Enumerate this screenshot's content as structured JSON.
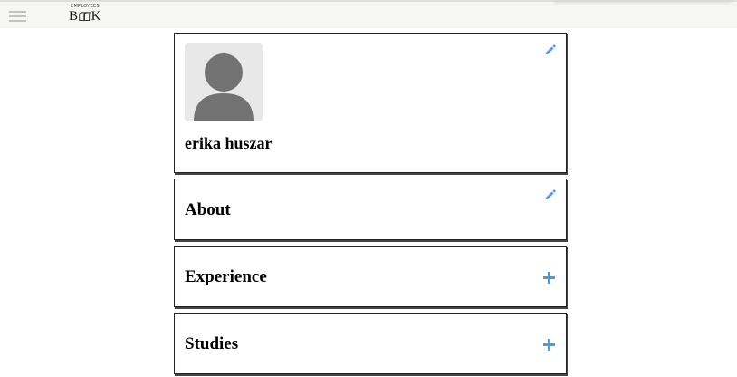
{
  "header": {
    "logo_small": "EMPLOYEES",
    "logo_b": "B",
    "logo_k": "K",
    "menu_icon": "hamburger-icon"
  },
  "profile": {
    "name": "erika huszar",
    "avatar_icon": "default-avatar-icon",
    "edit_icon": "pencil-icon"
  },
  "sections": {
    "about": {
      "title": "About",
      "action_icon": "pencil-icon"
    },
    "experience": {
      "title": "Experience",
      "action_icon": "plus-icon"
    },
    "studies": {
      "title": "Studies",
      "action_icon": "plus-icon"
    }
  },
  "colors": {
    "accent": "#4a9be0",
    "topbar_bg": "#f6f6f4",
    "avatar_bg": "#e8e8e8",
    "avatar_fg": "#727272"
  }
}
